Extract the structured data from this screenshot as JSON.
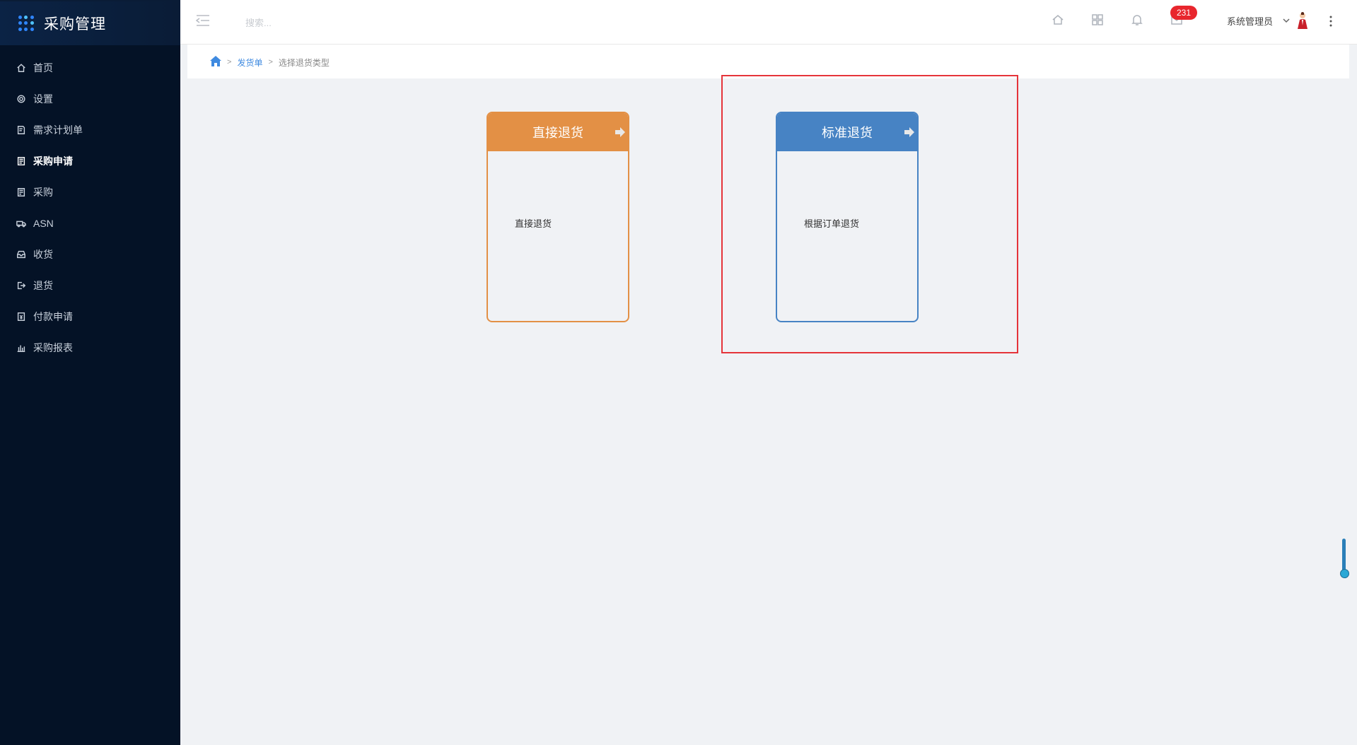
{
  "app": {
    "title": "采购管理"
  },
  "sidebar": {
    "items": [
      {
        "label": "首页",
        "icon": "home-icon",
        "active": false
      },
      {
        "label": "设置",
        "icon": "gear-icon",
        "active": false
      },
      {
        "label": "需求计划单",
        "icon": "document-edit-icon",
        "active": false
      },
      {
        "label": "采购申请",
        "icon": "clipboard-icon",
        "active": true
      },
      {
        "label": "采购",
        "icon": "list-icon",
        "active": false
      },
      {
        "label": "ASN",
        "icon": "truck-icon",
        "active": false
      },
      {
        "label": "收货",
        "icon": "inbox-icon",
        "active": false
      },
      {
        "label": "退货",
        "icon": "exit-icon",
        "active": false
      },
      {
        "label": "付款申请",
        "icon": "payment-icon",
        "active": false
      },
      {
        "label": "采购报表",
        "icon": "bar-chart-icon",
        "active": false
      }
    ]
  },
  "header": {
    "search_placeholder": "搜索...",
    "message_count": "231",
    "user_name": "系统管理员"
  },
  "breadcrumb": {
    "link": "发货单",
    "current": "选择退货类型",
    "separator": ">"
  },
  "cards": {
    "direct": {
      "title": "直接退货",
      "description": "直接退货",
      "color": "#e39045"
    },
    "standard": {
      "title": "标准退货",
      "description": "根据订单退货",
      "color": "#4783c4"
    }
  },
  "highlight_color": "#e5343a"
}
